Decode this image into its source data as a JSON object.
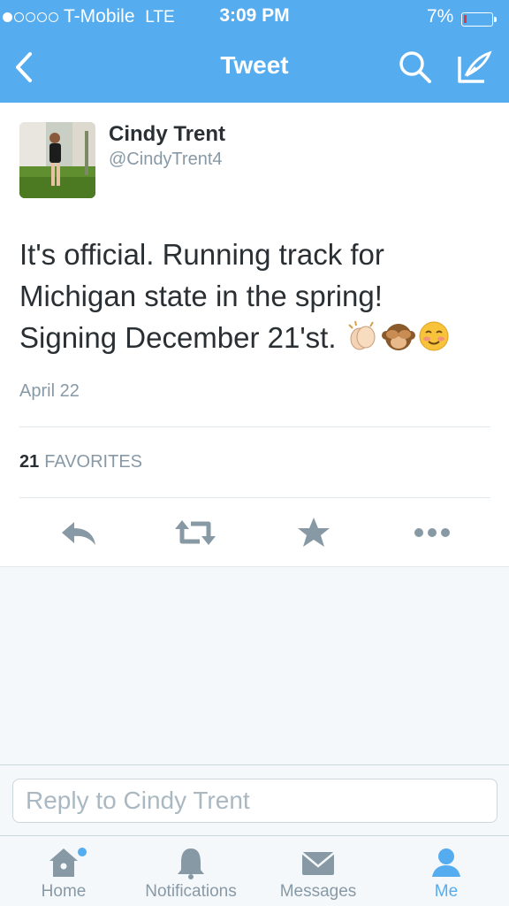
{
  "status_bar": {
    "carrier": "T-Mobile",
    "network": "LTE",
    "time": "3:09 PM",
    "battery": "7%",
    "signal_bars_filled": 1,
    "signal_bars_total": 5
  },
  "nav": {
    "title": "Tweet",
    "back_icon": "chevron-left-icon",
    "search_icon": "search-icon",
    "compose_icon": "compose-icon"
  },
  "tweet": {
    "author_name": "Cindy Trent",
    "author_handle": "@CindyTrent4",
    "text_line1": "It's official. Running track for",
    "text_line2": "Michigan state in the spring!",
    "text_line3": "Signing December 21'st.",
    "emojis": [
      "clapping-hands-emoji",
      "see-no-evil-monkey-emoji",
      "smiling-face-emoji"
    ],
    "date": "April 22",
    "favorites_count": "21",
    "favorites_label": "FAVORITES"
  },
  "actions": [
    "reply-icon",
    "retweet-icon",
    "favorite-star-icon",
    "more-icon"
  ],
  "reply": {
    "placeholder": "Reply to Cindy Trent"
  },
  "tabs": [
    {
      "label": "Home",
      "icon": "home-icon",
      "active": false,
      "notification_dot": true
    },
    {
      "label": "Notifications",
      "icon": "bell-icon",
      "active": false
    },
    {
      "label": "Messages",
      "icon": "envelope-icon",
      "active": false
    },
    {
      "label": "Me",
      "icon": "person-icon",
      "active": true
    }
  ],
  "colors": {
    "brand_blue": "#55acee",
    "text_dark": "#292f33",
    "text_gray": "#8899a6",
    "battery_low": "#e0383e"
  }
}
